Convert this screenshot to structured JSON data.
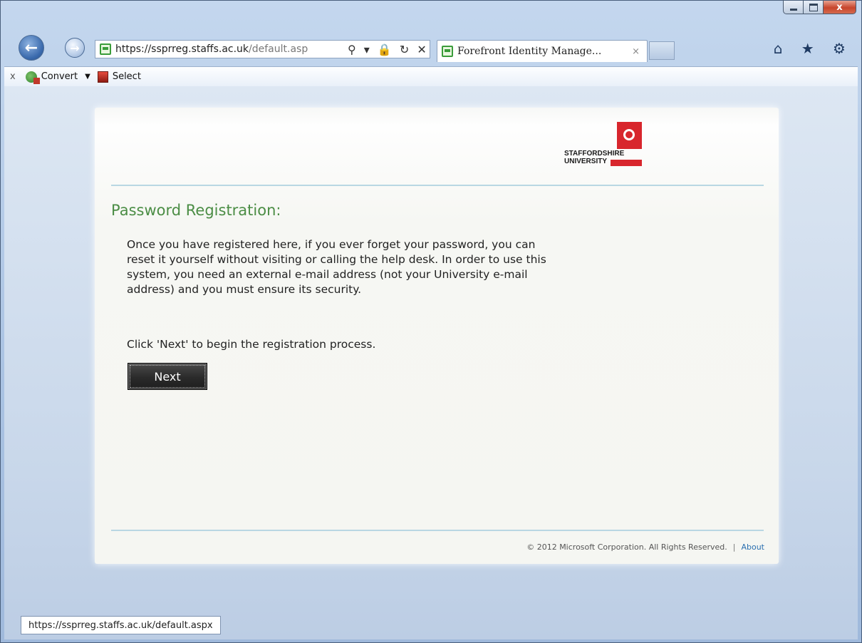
{
  "browser": {
    "address_url_main": "https://ssprreg.staffs.ac.uk",
    "address_url_rest": "/default.asp",
    "tab_title": "Forefront Identity Manage...",
    "tab_close": "×",
    "address_icons": "⚲ ▾ 🔒 ↻ ✕",
    "right_icons": "⌂ ★ ⚙",
    "window_controls": {
      "close": "x"
    }
  },
  "command_bar": {
    "close": "x",
    "convert_label": "Convert",
    "caret": "▼",
    "select_label": "Select"
  },
  "page": {
    "logo_text": "STAFFORDSHIRE\nUNIVERSITY",
    "heading": "Password Registration:",
    "intro": "Once you have registered here, if you ever forget your password, you can reset it yourself without visiting or calling the help desk. In order to use this system, you need an external e-mail address (not your University e-mail address) and you must ensure its security.",
    "instruction": "Click 'Next' to begin the registration process.",
    "next_label": "Next",
    "footer_copyright": "© 2012 Microsoft Corporation. All Rights Reserved.",
    "footer_separator": "|",
    "footer_about": "About"
  },
  "status_bar": {
    "url": "https://ssprreg.staffs.ac.uk/default.aspx"
  },
  "colors": {
    "heading_green": "#4b8d45",
    "logo_red": "#d8262d",
    "button_dark": "#2a2a2a",
    "link_blue": "#2a6fb0",
    "rule_blue": "#b9d7e3"
  }
}
